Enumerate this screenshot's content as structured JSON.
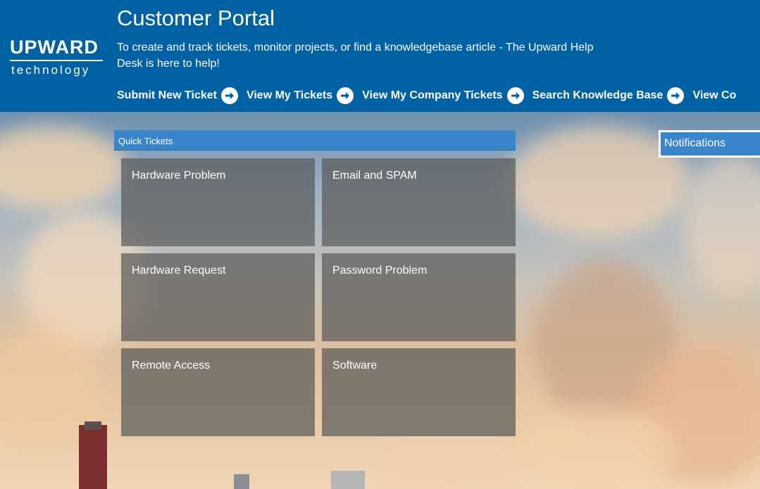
{
  "header": {
    "logo_top": "UPWARD",
    "logo_bottom": "technology",
    "title": "Customer Portal",
    "subtitle": "To create and track tickets, monitor projects, or find a knowledgebase article - The Upward Help Desk is here to help!"
  },
  "nav": {
    "items": [
      {
        "label": "Submit New Ticket",
        "icon": "arrow-right-circle-icon"
      },
      {
        "label": "View My Tickets",
        "icon": "arrow-right-circle-icon"
      },
      {
        "label": "View My Company Tickets",
        "icon": "arrow-right-circle-icon"
      },
      {
        "label": "Search Knowledge Base",
        "icon": "arrow-right-circle-icon"
      },
      {
        "label": "View Co",
        "icon": "arrow-right-circle-icon"
      }
    ]
  },
  "quick_tickets": {
    "heading": "Quick Tickets",
    "tiles": [
      {
        "label": "Hardware Problem"
      },
      {
        "label": "Email and SPAM"
      },
      {
        "label": "Hardware Request"
      },
      {
        "label": "Password Problem"
      },
      {
        "label": "Remote Access"
      },
      {
        "label": "Software"
      }
    ]
  },
  "notifications": {
    "heading": "Notifications"
  },
  "colors": {
    "header_bg": "#0061a3",
    "accent": "#3a84c9",
    "tile_bg": "rgba(90,90,90,0.72)"
  }
}
